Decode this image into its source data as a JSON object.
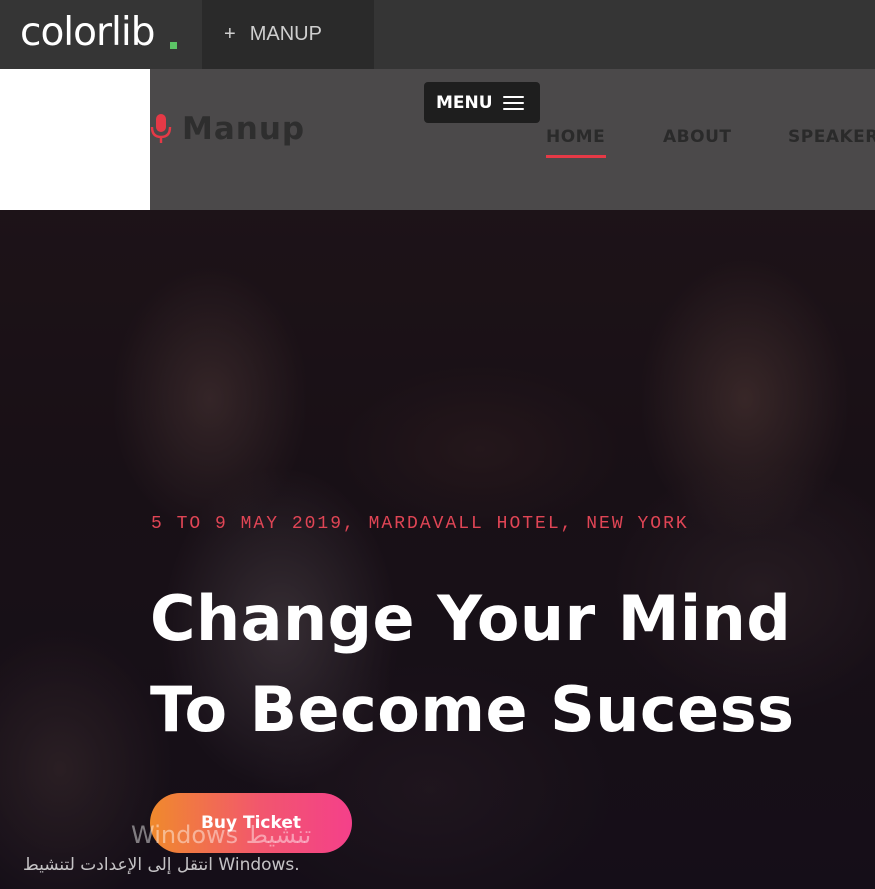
{
  "topbar": {
    "brand": "colorlib",
    "brand_dot": ".",
    "tab": {
      "icon": "plus-icon",
      "plus": "+",
      "label": "MANUP"
    }
  },
  "header": {
    "logo": {
      "icon": "microphone-icon",
      "text": "Manup",
      "icon_color": "#e63946"
    },
    "menu_button": {
      "label": "MENU",
      "icon": "hamburger-icon"
    },
    "nav": [
      {
        "label": "HOME",
        "active": true
      },
      {
        "label": "ABOUT",
        "active": false
      },
      {
        "label": "SPEAKERS",
        "active": false
      }
    ],
    "accent": "#e63946"
  },
  "hero": {
    "event_info": "5 TO 9 MAY 2019, MARDAVALL HOTEL, NEW YORK",
    "title_line1": "Change Your Mind",
    "title_line2": "To Become Sucess",
    "cta": "Buy Ticket",
    "cta_gradient": [
      "#f08a2c",
      "#f4408a"
    ]
  },
  "watermark": {
    "line1": "تنشيط Windows",
    "line2": "انتقل إلى الإعدادت لتنشيط Windows."
  }
}
